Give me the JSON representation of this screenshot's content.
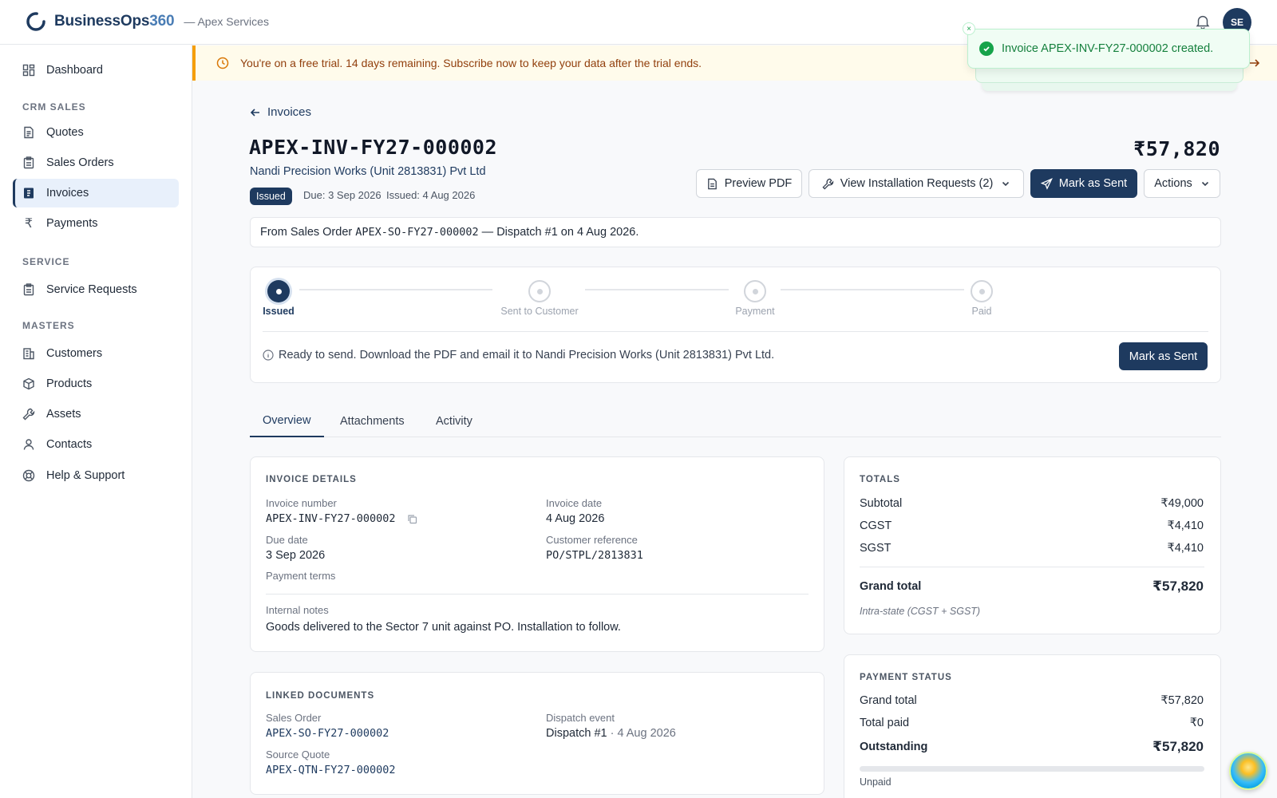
{
  "brand": {
    "name": "BusinessOps",
    "name_num": "360",
    "org": "— Apex Services"
  },
  "user": {
    "initials": "SE"
  },
  "sidebar": {
    "dashboard": "Dashboard",
    "sections": {
      "crm": "CRM SALES",
      "service": "SERVICE",
      "masters": "MASTERS"
    },
    "items": {
      "quotes": "Quotes",
      "sales_orders": "Sales Orders",
      "invoices": "Invoices",
      "payments": "Payments",
      "service_requests": "Service Requests",
      "customers": "Customers",
      "products": "Products",
      "assets": "Assets",
      "contacts": "Contacts",
      "help": "Help & Support"
    }
  },
  "trial_banner": "You're on a free trial. 14 days remaining. Subscribe now to keep your data after the trial ends.",
  "toast": {
    "message": "Invoice APEX-INV-FY27-000002 created.",
    "close": "×"
  },
  "header": {
    "back_label": "Invoices",
    "invoice_number": "APEX-INV-FY27-000002",
    "customer": "Nandi Precision Works (Unit 2813831) Pvt Ltd",
    "status": "Issued",
    "due": "Due: 3 Sep 2026",
    "issued": "Issued: 4 Aug 2026",
    "amount": "₹57,820"
  },
  "actions": {
    "preview_pdf": "Preview PDF",
    "view_installation": "View Installation Requests (2)",
    "mark_sent": "Mark as Sent",
    "actions": "Actions"
  },
  "from_box": {
    "prefix": "From Sales Order",
    "so_number": "APEX-SO-FY27-000002",
    "suffix": "— Dispatch #1 on 4 Aug 2026."
  },
  "progress": {
    "steps": [
      "Issued",
      "Sent to Customer",
      "Payment",
      "Paid"
    ],
    "current_step": 0,
    "message": "Ready to send. Download the PDF and email it to Nandi Precision Works (Unit 2813831) Pvt Ltd.",
    "action": "Mark as Sent"
  },
  "tabs": [
    "Overview",
    "Attachments",
    "Activity"
  ],
  "invoice_details": {
    "title": "INVOICE DETAILS",
    "invoice_number_label": "Invoice number",
    "invoice_number": "APEX-INV-FY27-000002",
    "invoice_date_label": "Invoice date",
    "invoice_date": "4 Aug 2026",
    "due_date_label": "Due date",
    "due_date": "3 Sep 2026",
    "customer_ref_label": "Customer reference",
    "customer_ref": "PO/STPL/2813831",
    "payment_terms_label": "Payment terms",
    "internal_notes_label": "Internal notes",
    "internal_notes": "Goods delivered to the Sector 7 unit against PO. Installation to follow."
  },
  "linked_documents": {
    "title": "LINKED DOCUMENTS",
    "sales_order_label": "Sales Order",
    "sales_order": "APEX-SO-FY27-000002",
    "dispatch_label": "Dispatch event",
    "dispatch": "Dispatch #1",
    "dispatch_date": "· 4 Aug 2026",
    "source_quote_label": "Source Quote",
    "source_quote": "APEX-QTN-FY27-000002"
  },
  "totals": {
    "title": "TOTALS",
    "subtotal_label": "Subtotal",
    "subtotal": "₹49,000",
    "cgst_label": "CGST",
    "cgst": "₹4,410",
    "sgst_label": "SGST",
    "sgst": "₹4,410",
    "grand_total_label": "Grand total",
    "grand_total": "₹57,820",
    "tax_note": "Intra-state (CGST + SGST)"
  },
  "payment_status": {
    "title": "PAYMENT STATUS",
    "grand_total_label": "Grand total",
    "grand_total": "₹57,820",
    "total_paid_label": "Total paid",
    "total_paid": "₹0",
    "outstanding_label": "Outstanding",
    "outstanding": "₹57,820",
    "paid_fraction": 0,
    "status": "Unpaid"
  },
  "colors": {
    "primary": "#1e3a5f",
    "success": "#16a34a",
    "warning": "#f59e0b"
  }
}
